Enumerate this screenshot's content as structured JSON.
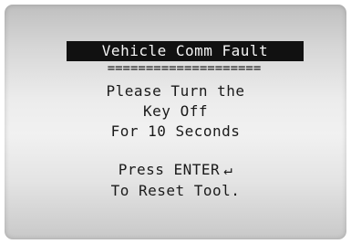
{
  "screen": {
    "title": "Vehicle Comm Fault",
    "divider": "====================",
    "lines": [
      "Please Turn the",
      "Key Off",
      "For 10 Seconds"
    ],
    "prompt_text": "Press ENTER",
    "enter_icon": "↵",
    "prompt_line2": "To Reset Tool."
  }
}
